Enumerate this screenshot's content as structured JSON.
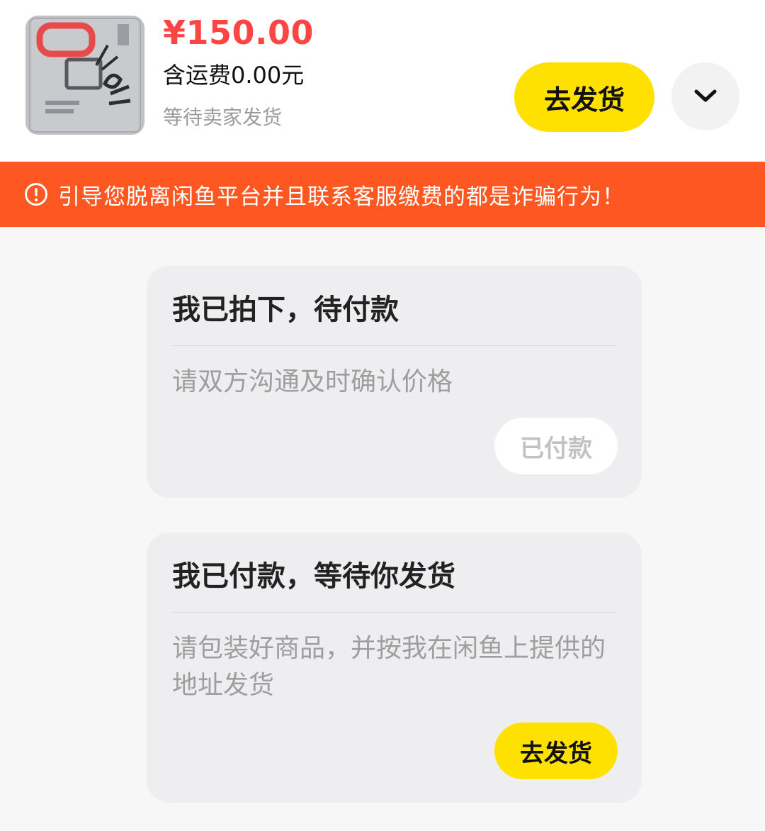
{
  "order": {
    "price": "¥150.00",
    "shipping_fee": "含运费0.00元",
    "status": "等待卖家发货",
    "ship_button": "去发货",
    "thumbnail_icon": "product-photo"
  },
  "warning_banner": {
    "icon": "exclamation-circle-icon",
    "text": "引导您脱离闲鱼平台并且联系客服缴费的都是诈骗行为！"
  },
  "messages": [
    {
      "title": "我已拍下，待付款",
      "body": "请双方沟通及时确认价格",
      "action": "已付款",
      "action_enabled": false
    },
    {
      "title": "我已付款，等待你发货",
      "body": "请包装好商品，并按我在闲鱼上提供的地址发货",
      "action": "去发货",
      "action_enabled": true
    }
  ],
  "colors": {
    "price": "#ff4444",
    "accent_yellow": "#ffe100",
    "warning_bg": "#ff5722",
    "card_bg": "#eeeef0"
  }
}
